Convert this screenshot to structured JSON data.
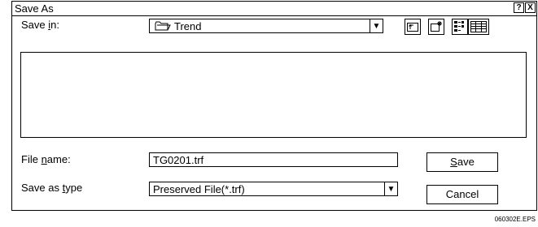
{
  "window": {
    "title": "Save As",
    "help_button": "?",
    "close_button": "X"
  },
  "save_in": {
    "label_pre": "Save ",
    "label_key": "i",
    "label_post": "n:",
    "value": "Trend",
    "icon": "folder-icon"
  },
  "toolbar": {
    "icons": [
      "up-one-level-icon",
      "create-new-folder-icon",
      "list-view-icon",
      "details-view-icon"
    ]
  },
  "file_name": {
    "label_pre": "File ",
    "label_key": "n",
    "label_post": "ame:",
    "value": "TG0201.trf"
  },
  "save_as_type": {
    "label_pre": "Save as ",
    "label_key": "t",
    "label_post": "ype",
    "value": "Preserved File(*.trf)"
  },
  "buttons": {
    "save_key": "S",
    "save_rest": "ave",
    "cancel": "Cancel"
  },
  "figure_code": "060302E.EPS"
}
